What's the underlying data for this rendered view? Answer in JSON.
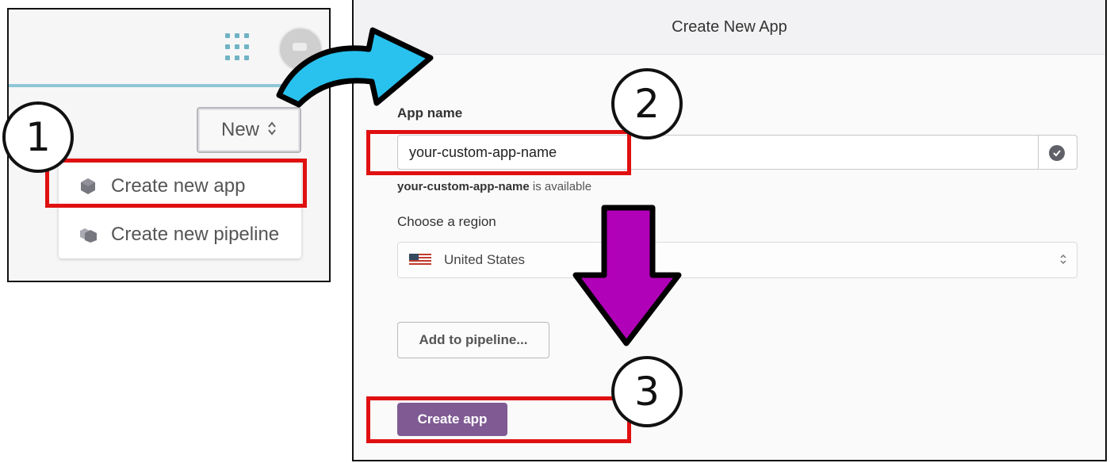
{
  "left_panel": {
    "new_button": {
      "label": "New",
      "chevron": "⌃⌄"
    },
    "dropdown": {
      "items": [
        {
          "label": "Create new app",
          "icon": "app-cube-icon"
        },
        {
          "label": "Create new pipeline",
          "icon": "pipeline-cubes-icon"
        }
      ]
    },
    "icons": {
      "apps_grid": "grid-icon",
      "avatar": "avatar"
    }
  },
  "right_panel": {
    "title": "Create New App",
    "app_name_label": "App name",
    "app_name_value": "your-custom-app-name",
    "availability": {
      "name": "your-custom-app-name",
      "suffix": " is available"
    },
    "region_label": "Choose a region",
    "region_value": "United States",
    "region_flag": "us-flag-icon",
    "add_pipeline_label": "Add to pipeline...",
    "create_button_label": "Create app"
  },
  "annotations": {
    "steps": [
      "1",
      "2",
      "3"
    ],
    "colors": {
      "highlight_box": "#e01010",
      "arrow_blue": "#29c1ee",
      "arrow_purple": "#b000b8",
      "create_button": "#7f5a93"
    }
  }
}
